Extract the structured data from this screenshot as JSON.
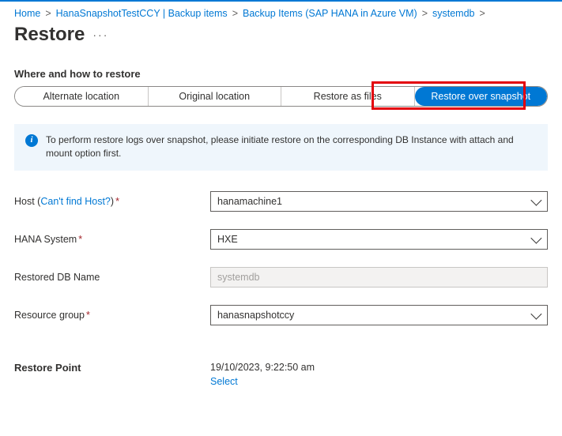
{
  "breadcrumb": {
    "items": [
      {
        "label": "Home"
      },
      {
        "label": "HanaSnapshotTestCCY | Backup items"
      },
      {
        "label": "Backup Items (SAP HANA in Azure VM)"
      },
      {
        "label": "systemdb"
      }
    ],
    "sep": ">"
  },
  "page": {
    "title": "Restore",
    "more": "···"
  },
  "restore_mode": {
    "section_label": "Where and how to restore",
    "tabs": [
      {
        "label": "Alternate location",
        "active": false
      },
      {
        "label": "Original location",
        "active": false
      },
      {
        "label": "Restore as files",
        "active": false
      },
      {
        "label": "Restore over snapshot",
        "active": true
      }
    ]
  },
  "info": {
    "icon_text": "i",
    "text": "To perform restore logs over snapshot, please initiate restore on the corresponding DB Instance with attach and mount option first."
  },
  "form": {
    "host": {
      "label_pre": "Host (",
      "link": "Can't find Host?",
      "label_post": ")",
      "value": "hanamachine1"
    },
    "hana_system": {
      "label": "HANA System",
      "value": "HXE"
    },
    "restored_db": {
      "label": "Restored DB Name",
      "placeholder": "systemdb"
    },
    "resource_group": {
      "label": "Resource group",
      "value": "hanasnapshotccy"
    }
  },
  "restore_point": {
    "label": "Restore Point",
    "value": "19/10/2023, 9:22:50 am",
    "select": "Select"
  }
}
